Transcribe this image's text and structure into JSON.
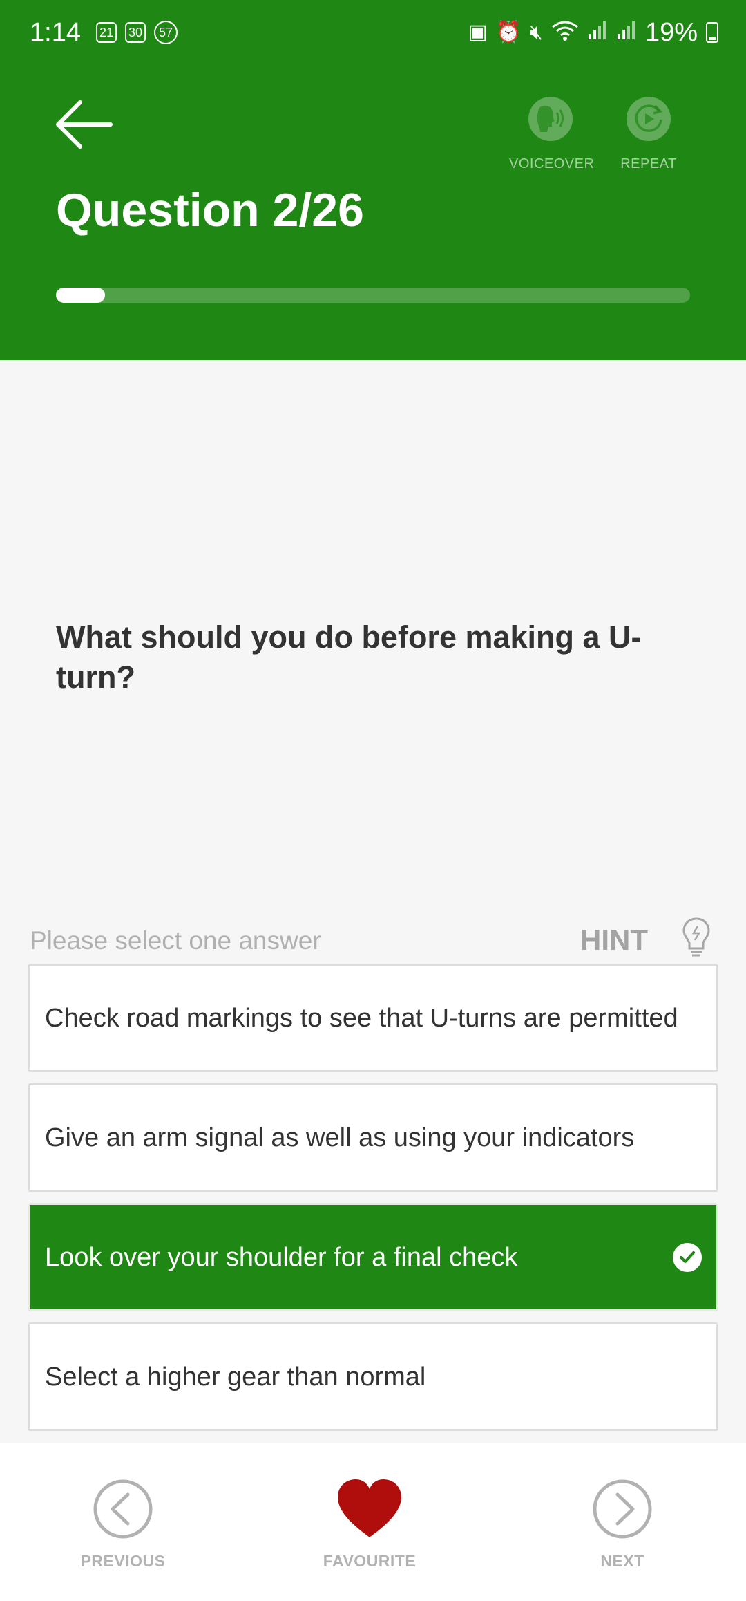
{
  "status_bar": {
    "time": "1:14",
    "badges": [
      "21",
      "30",
      "57"
    ],
    "battery": "19%"
  },
  "header": {
    "title": "Question 2/26",
    "voiceover_label": "VOICEOVER",
    "repeat_label": "REPEAT",
    "progress_fraction": 0.0769,
    "bg_color": "#1f8714"
  },
  "question": {
    "text": "What should you do before making a U-turn?"
  },
  "answer_section": {
    "prompt": "Please select one answer",
    "hint_label": "HINT"
  },
  "answers": [
    {
      "label": "Check road markings to see that U-turns are permitted",
      "selected": false
    },
    {
      "label": "Give an arm signal as well as using your indicators",
      "selected": false
    },
    {
      "label": "Look over your shoulder for a final check",
      "selected": true
    },
    {
      "label": "Select a higher gear than normal",
      "selected": false
    }
  ],
  "bottom_nav": {
    "previous_label": "PREVIOUS",
    "favourite_label": "FAVOURITE",
    "next_label": "NEXT",
    "heart_color": "#b00d0d"
  }
}
